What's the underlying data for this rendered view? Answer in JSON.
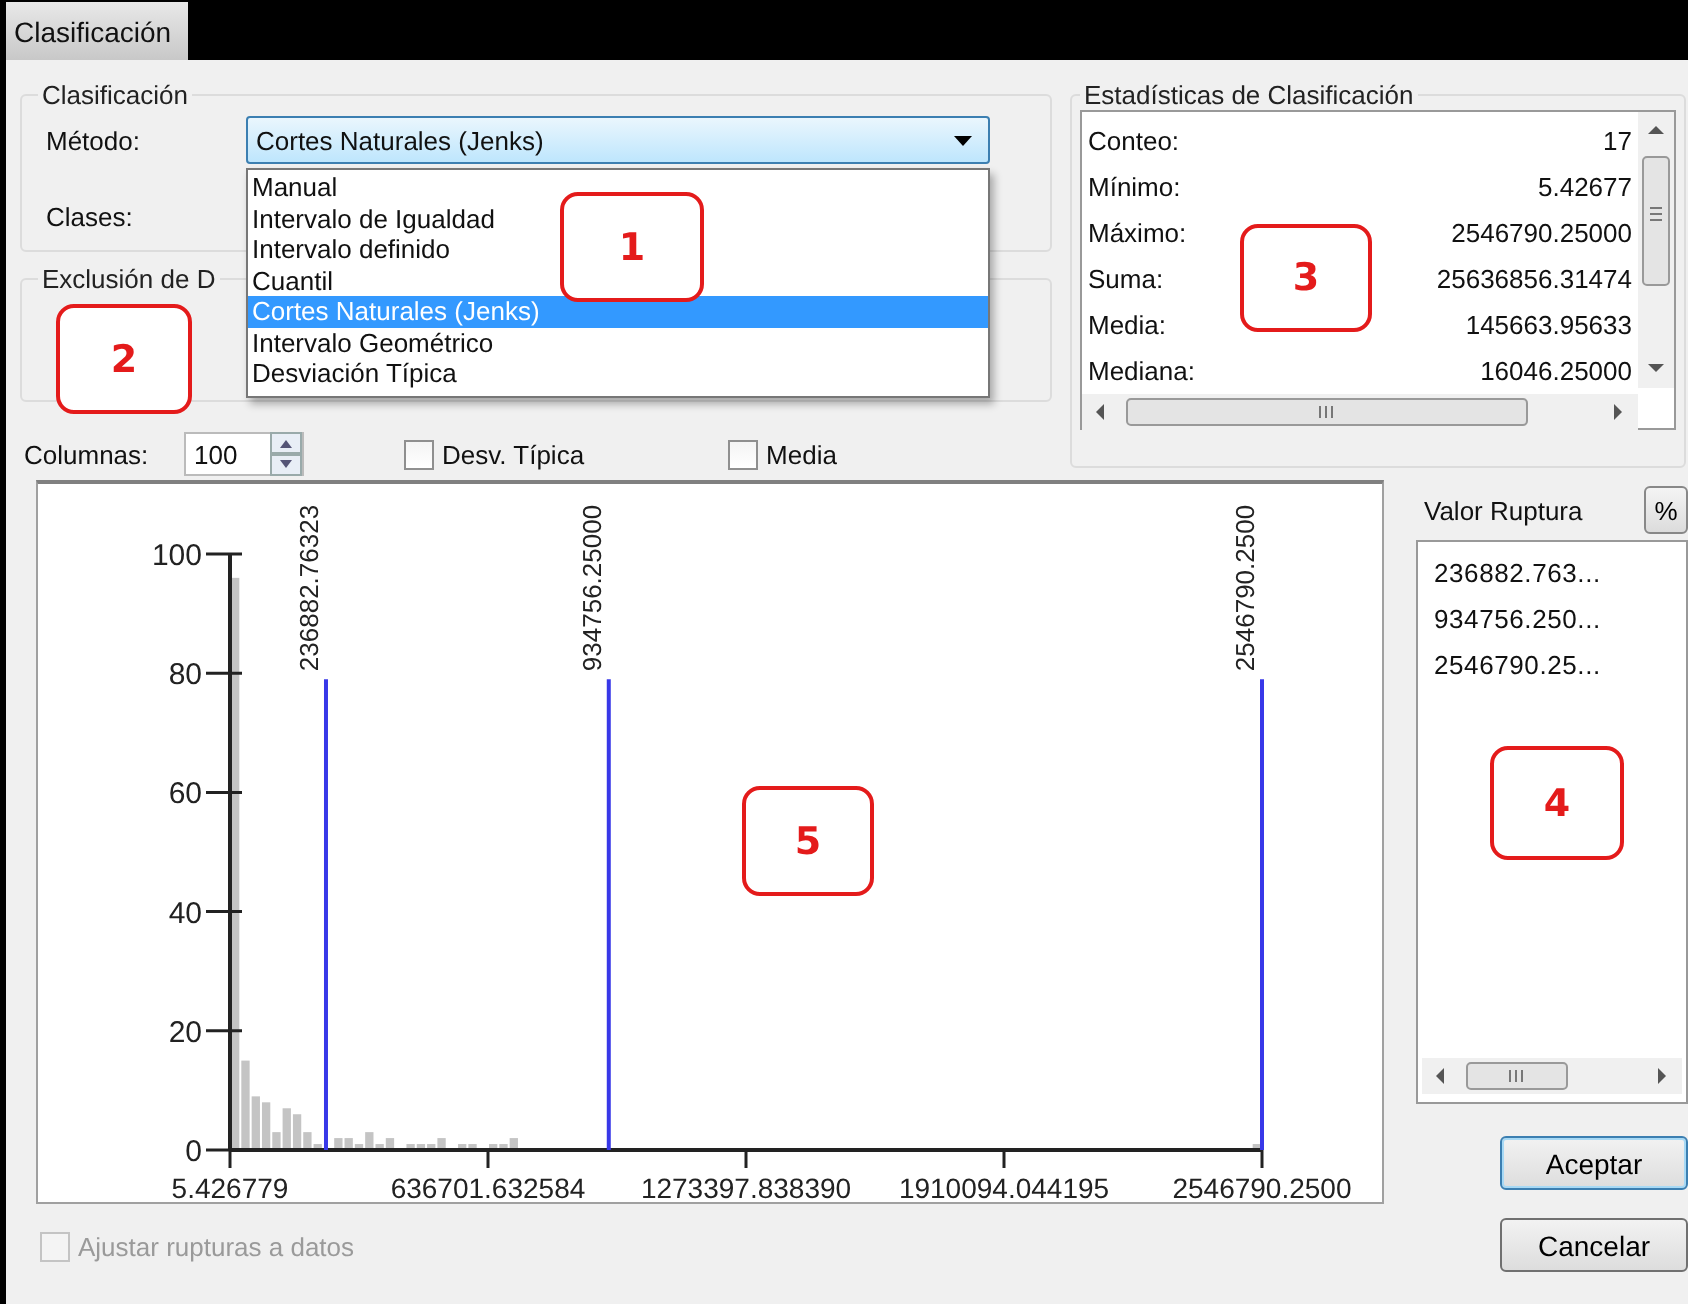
{
  "tabs": [
    {
      "label": "Clasificación",
      "selected": true
    }
  ],
  "classification": {
    "title": "Clasificación",
    "method_label": "Método:",
    "method_value": "Cortes Naturales (Jenks)",
    "classes_label": "Clases:",
    "method_options": [
      {
        "label": "Manual",
        "selected": false
      },
      {
        "label": "Intervalo de Igualdad",
        "selected": false
      },
      {
        "label": "Intervalo definido",
        "selected": false
      },
      {
        "label": "Cuantil",
        "selected": false
      },
      {
        "label": "Cortes Naturales (Jenks)",
        "selected": true
      },
      {
        "label": "Intervalo Geométrico",
        "selected": false
      },
      {
        "label": "Desviación Típica",
        "selected": false
      }
    ]
  },
  "exclusion": {
    "title": "Exclusión de D"
  },
  "columns": {
    "label": "Columnas:",
    "value": "100"
  },
  "options": [
    {
      "label": "Desv. Típica",
      "checked": false,
      "disabled": false
    },
    {
      "label": "Media",
      "checked": false,
      "disabled": false
    }
  ],
  "statistics": {
    "title": "Estadísticas de Clasificación",
    "rows": [
      {
        "label": "Conteo:",
        "value": "17"
      },
      {
        "label": "Mínimo:",
        "value": "5.42677"
      },
      {
        "label": "Máximo:",
        "value": "2546790.25000"
      },
      {
        "label": "Suma:",
        "value": "25636856.31474"
      },
      {
        "label": "Media:",
        "value": "145663.95633"
      },
      {
        "label": "Mediana:",
        "value": "16046.25000"
      }
    ]
  },
  "histogram": {
    "chart_data": {
      "type": "bar",
      "xlim": [
        5.426779,
        2546790.25
      ],
      "ylim": [
        0,
        100
      ],
      "yticks": [
        0,
        20,
        40,
        60,
        80,
        100
      ],
      "xticks": [
        {
          "value": 5.426779,
          "label": "5.426779"
        },
        {
          "value": 636701.632584,
          "label": "636701.632584"
        },
        {
          "value": 1273397.83839,
          "label": "1273397.838390"
        },
        {
          "value": 1910094.044195,
          "label": "1910094.044195"
        },
        {
          "value": 2546790.25,
          "label": "2546790.2500"
        }
      ],
      "x": [
        12739,
        38207,
        63675,
        89143,
        114611,
        140079,
        165546,
        191014,
        216482,
        267418,
        292886,
        318353,
        343821,
        369289,
        394757,
        445693,
        471160,
        496628,
        522096,
        573032,
        598499,
        649435,
        674903,
        700371,
        2534056
      ],
      "values": [
        96,
        15,
        9,
        8,
        3,
        7,
        6,
        3,
        1,
        2,
        2,
        1,
        3,
        1,
        2,
        1,
        1,
        1,
        2,
        1,
        1,
        1,
        1,
        2,
        1
      ],
      "ref_lines": [
        {
          "axis": "x",
          "value": 236882.76323,
          "label": "236882.76323"
        },
        {
          "axis": "x",
          "value": 934756.25,
          "label": "934756.25000"
        },
        {
          "axis": "x",
          "value": 2546790.25,
          "label": "2546790.2500"
        }
      ]
    }
  },
  "break_values": {
    "title": "Valor Ruptura",
    "percent_button": "%",
    "items": [
      "236882.763...",
      "934756.250...",
      "2546790.25..."
    ]
  },
  "snap": {
    "label": "Ajustar rupturas a datos",
    "checked": false,
    "disabled": true
  },
  "buttons": [
    "Aceptar",
    "Cancelar"
  ],
  "callouts": [
    {
      "label": "1"
    },
    {
      "label": "2"
    },
    {
      "label": "3"
    },
    {
      "label": "4"
    },
    {
      "label": "5"
    }
  ]
}
